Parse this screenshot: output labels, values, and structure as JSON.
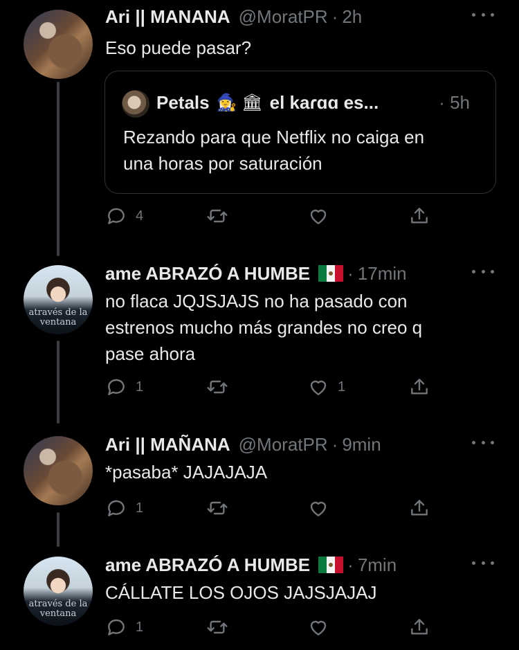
{
  "tweets": [
    {
      "name": "Ari || MANANA",
      "handle": "@MoratPR",
      "sep": "·",
      "time": "2h",
      "text": "Eso puede pasar?",
      "quote": {
        "name": "Petals",
        "emoji": "🧙‍♀️ 🏛",
        "name_cont": "el kaɾɑɑ es...",
        "sep": "·",
        "time": "5h",
        "text": "Rezando para que Netflix no caiga en\nuna horas por saturación"
      },
      "reply_count": "4",
      "retweet_count": "",
      "like_count": ""
    },
    {
      "name": "ame ABRAZÓ A HUMBE",
      "flag": "mexico-flag",
      "sep": "·",
      "time": "17min",
      "text": "no flaca JQJSJAJS no ha pasado con\nestrenos mucho más grandes no creo q\npase ahora",
      "avatar_text": "através de la\nventana",
      "reply_count": "1",
      "retweet_count": "",
      "like_count": "1"
    },
    {
      "name": "Ari || MAÑANA",
      "handle": "@MoratPR",
      "sep": "·",
      "time": "9min",
      "text": "*pasaba* JAJAJAJA",
      "reply_count": "1",
      "retweet_count": "",
      "like_count": ""
    },
    {
      "name": "ame ABRAZÓ A HUMBE",
      "flag": "mexico-flag",
      "sep": "·",
      "time": "7min",
      "text": "CÁLLATE LOS OJOS JAJSJAJAJ",
      "avatar_text": "através de la\nventana",
      "reply_count": "1",
      "retweet_count": "",
      "like_count": ""
    }
  ],
  "colors": {
    "background": "#000000",
    "text": "#e7e9ea",
    "muted": "#71767b",
    "border": "#2f3336",
    "thread_line": "#3a3d41"
  },
  "icons": [
    "reply-icon",
    "retweet-icon",
    "like-icon",
    "share-icon",
    "more-icon"
  ]
}
